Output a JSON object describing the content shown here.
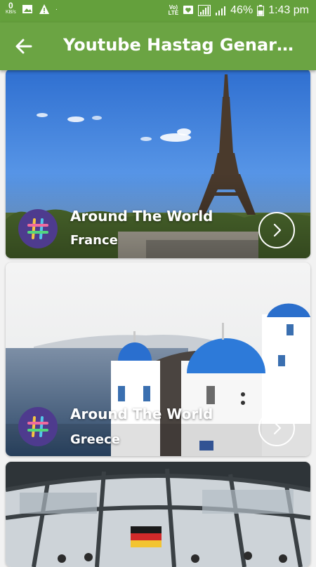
{
  "status_bar": {
    "net_speed_value": "0",
    "net_speed_unit": "KB/s",
    "volte_top": "Vo)",
    "volte_bottom": "LTE",
    "battery": "46%",
    "time": "1:43 pm",
    "dot": "·"
  },
  "app_bar": {
    "title": "Youtube Hastag Genarat…"
  },
  "cards": [
    {
      "title": "Around The World",
      "subtitle": "France"
    },
    {
      "title": "Around The World",
      "subtitle": "Greece"
    }
  ],
  "colors": {
    "status_bar": "#64a03c",
    "app_bar": "#6ba443",
    "badge": "#4e3b8e"
  },
  "icons": [
    "gallery-icon",
    "warning-icon",
    "chat-icon",
    "signal-icon",
    "battery-icon",
    "back-arrow-icon",
    "hashtag-icon",
    "chevron-right-icon"
  ]
}
